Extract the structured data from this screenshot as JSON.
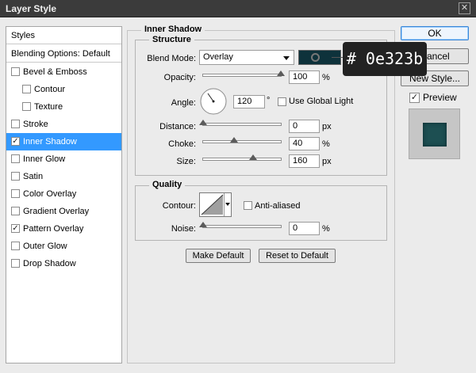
{
  "window": {
    "title": "Layer Style",
    "close_glyph": "✕"
  },
  "styles_panel": {
    "header": "Styles",
    "blending_options": "Blending Options: Default",
    "items": [
      {
        "label": "Bevel & Emboss",
        "checked": false,
        "sub": false,
        "selected": false
      },
      {
        "label": "Contour",
        "checked": false,
        "sub": true,
        "selected": false
      },
      {
        "label": "Texture",
        "checked": false,
        "sub": true,
        "selected": false
      },
      {
        "label": "Stroke",
        "checked": false,
        "sub": false,
        "selected": false
      },
      {
        "label": "Inner Shadow",
        "checked": true,
        "sub": false,
        "selected": true
      },
      {
        "label": "Inner Glow",
        "checked": false,
        "sub": false,
        "selected": false
      },
      {
        "label": "Satin",
        "checked": false,
        "sub": false,
        "selected": false
      },
      {
        "label": "Color Overlay",
        "checked": false,
        "sub": false,
        "selected": false
      },
      {
        "label": "Gradient Overlay",
        "checked": false,
        "sub": false,
        "selected": false
      },
      {
        "label": "Pattern Overlay",
        "checked": true,
        "sub": false,
        "selected": false
      },
      {
        "label": "Outer Glow",
        "checked": false,
        "sub": false,
        "selected": false
      },
      {
        "label": "Drop Shadow",
        "checked": false,
        "sub": false,
        "selected": false
      }
    ]
  },
  "inner_shadow": {
    "section_title": "Inner Shadow",
    "structure": {
      "title": "Structure",
      "blend_mode_label": "Blend Mode:",
      "blend_mode_value": "Overlay",
      "shadow_color": "#0e323b",
      "opacity_label": "Opacity:",
      "opacity_value": "100",
      "opacity_unit": "%",
      "angle_label": "Angle:",
      "angle_value": "120",
      "angle_unit": "°",
      "use_global_light_label": "Use Global Light",
      "use_global_light_checked": false,
      "distance_label": "Distance:",
      "distance_value": "0",
      "distance_unit": "px",
      "choke_label": "Choke:",
      "choke_value": "40",
      "choke_unit": "%",
      "size_label": "Size:",
      "size_value": "160",
      "size_unit": "px"
    },
    "quality": {
      "title": "Quality",
      "contour_label": "Contour:",
      "anti_aliased_label": "Anti-aliased",
      "anti_aliased_checked": false,
      "noise_label": "Noise:",
      "noise_value": "0",
      "noise_unit": "%"
    },
    "make_default_label": "Make Default",
    "reset_default_label": "Reset to Default"
  },
  "sliders": {
    "opacity": 1.0,
    "distance": 0.0,
    "choke": 0.4,
    "size": 0.64,
    "noise": 0.0
  },
  "buttons": {
    "ok": "OK",
    "cancel": "Cancel",
    "new_style": "New Style..."
  },
  "preview": {
    "label": "Preview",
    "checked": true
  },
  "tooltip": {
    "text": "# 0e323b"
  },
  "colors": {
    "selection": "#3399ff",
    "titlebar": "#3b3b3b",
    "swatch": "#0e323b"
  }
}
